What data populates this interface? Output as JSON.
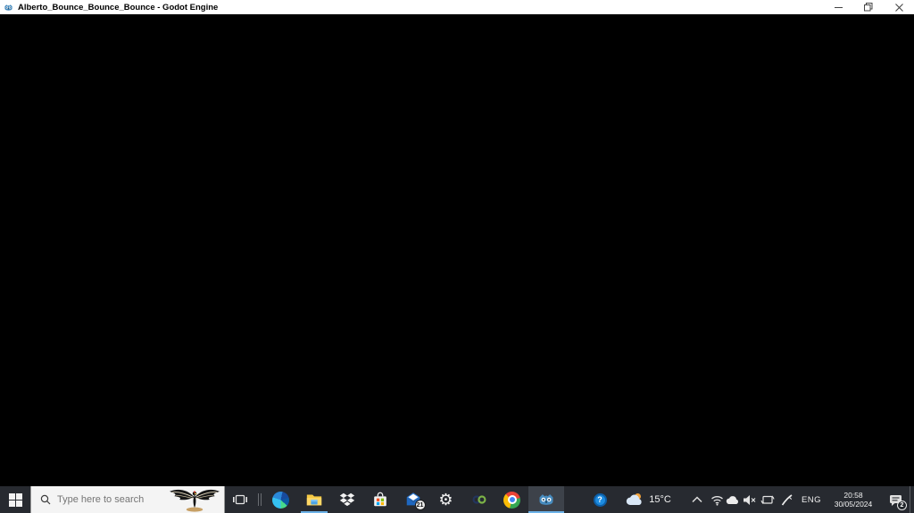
{
  "window": {
    "title": "Alberto_Bounce_Bounce_Bounce - Godot Engine",
    "app_icon": "godot-icon",
    "controls": [
      "minimize",
      "restore",
      "close"
    ]
  },
  "viewport": {
    "description": "running game scene, black screen",
    "background": "#000000"
  },
  "taskbar": {
    "search_placeholder": "Type here to search",
    "search_highlight": "condor-bird-image",
    "apps": [
      {
        "name": "task-view"
      },
      {
        "name": "microsoft-edge"
      },
      {
        "name": "file-explorer",
        "running": true
      },
      {
        "name": "dropbox"
      },
      {
        "name": "microsoft-store"
      },
      {
        "name": "mail",
        "badge": "21"
      },
      {
        "name": "settings"
      },
      {
        "name": "infinity-app"
      },
      {
        "name": "chrome"
      },
      {
        "name": "godot",
        "running": true,
        "active": true
      }
    ],
    "mail_badge": "21",
    "settings_glyph": "⚙",
    "tray": {
      "help_glyph": "?",
      "temperature": "15°C",
      "language": "ENG",
      "time": "20:58",
      "date": "30/05/2024",
      "notification_badge": "2",
      "icons": [
        "help-icon",
        "weather-cloud-icon",
        "chevron-up-icon",
        "wifi-icon",
        "onedrive-cloud-icon",
        "volume-muted-icon",
        "display-sync-icon",
        "pen-icon",
        "action-center-icon"
      ]
    }
  },
  "colors": {
    "titlebar_bg": "#ffffff",
    "taskbar_bg": "#272a30",
    "active_app_bg": "#3d424a",
    "running_underline": "#6cb2e8",
    "godot_blue": "#478cbf"
  }
}
